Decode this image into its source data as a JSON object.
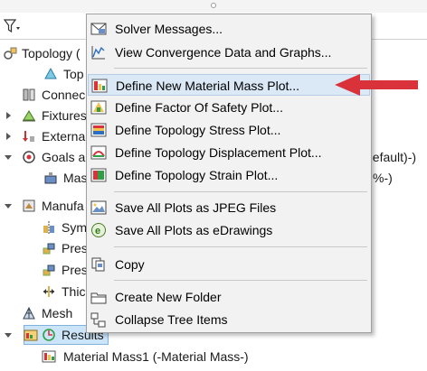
{
  "tree": {
    "items": [
      {
        "label": "Topology (",
        "icon": "topology-study-icon"
      },
      {
        "label": "Top",
        "icon": "topology-part-icon"
      },
      {
        "label": "Connec",
        "icon": "connections-icon"
      },
      {
        "label": "Fixtures",
        "icon": "fixtures-icon"
      },
      {
        "label": "Externa",
        "icon": "external-loads-icon"
      },
      {
        "label": "Goals a",
        "icon": "goals-icon",
        "tail": "default)-)"
      },
      {
        "label": "Mass",
        "icon": "mass-goal-icon",
        "tail": "%-)"
      },
      {
        "label": "Manufa",
        "icon": "manufacturing-controls-icon"
      },
      {
        "label": "Sym",
        "icon": "symmetry-icon"
      },
      {
        "label": "Pres",
        "icon": "preserved-region-icon"
      },
      {
        "label": "Pres",
        "icon": "preserved-region-icon"
      },
      {
        "label": "Thic",
        "icon": "thickness-control-icon"
      },
      {
        "label": "Mesh",
        "icon": "mesh-icon"
      },
      {
        "label": "Results",
        "icon": "results-icon"
      },
      {
        "label": "Material Mass1 (-Material Mass-)",
        "icon": "material-mass-plot-icon"
      }
    ]
  },
  "menu": {
    "items": [
      {
        "label": "Solver Messages...",
        "icon": "solver-messages-icon"
      },
      {
        "label": "View Convergence Data and Graphs...",
        "icon": "convergence-graph-icon"
      },
      {
        "label": "Define New Material Mass Plot...",
        "icon": "material-mass-plot-icon"
      },
      {
        "label": "Define Factor Of Safety Plot...",
        "icon": "factor-of-safety-plot-icon"
      },
      {
        "label": "Define Topology Stress Plot...",
        "icon": "stress-plot-icon"
      },
      {
        "label": "Define Topology Displacement Plot...",
        "icon": "displacement-plot-icon"
      },
      {
        "label": "Define Topology Strain Plot...",
        "icon": "strain-plot-icon"
      },
      {
        "label": "Save All Plots as JPEG Files",
        "icon": "save-jpeg-icon"
      },
      {
        "label": "Save All Plots as eDrawings",
        "icon": "edrawings-icon"
      },
      {
        "label": "Copy",
        "icon": "copy-icon"
      },
      {
        "label": "Create New Folder",
        "icon": "new-folder-icon"
      },
      {
        "label": "Collapse Tree Items",
        "icon": "collapse-tree-icon"
      }
    ]
  },
  "colors": {
    "highlight": "#dbe8f6",
    "selection": "#cce4f7",
    "arrow": "#d9323a"
  }
}
